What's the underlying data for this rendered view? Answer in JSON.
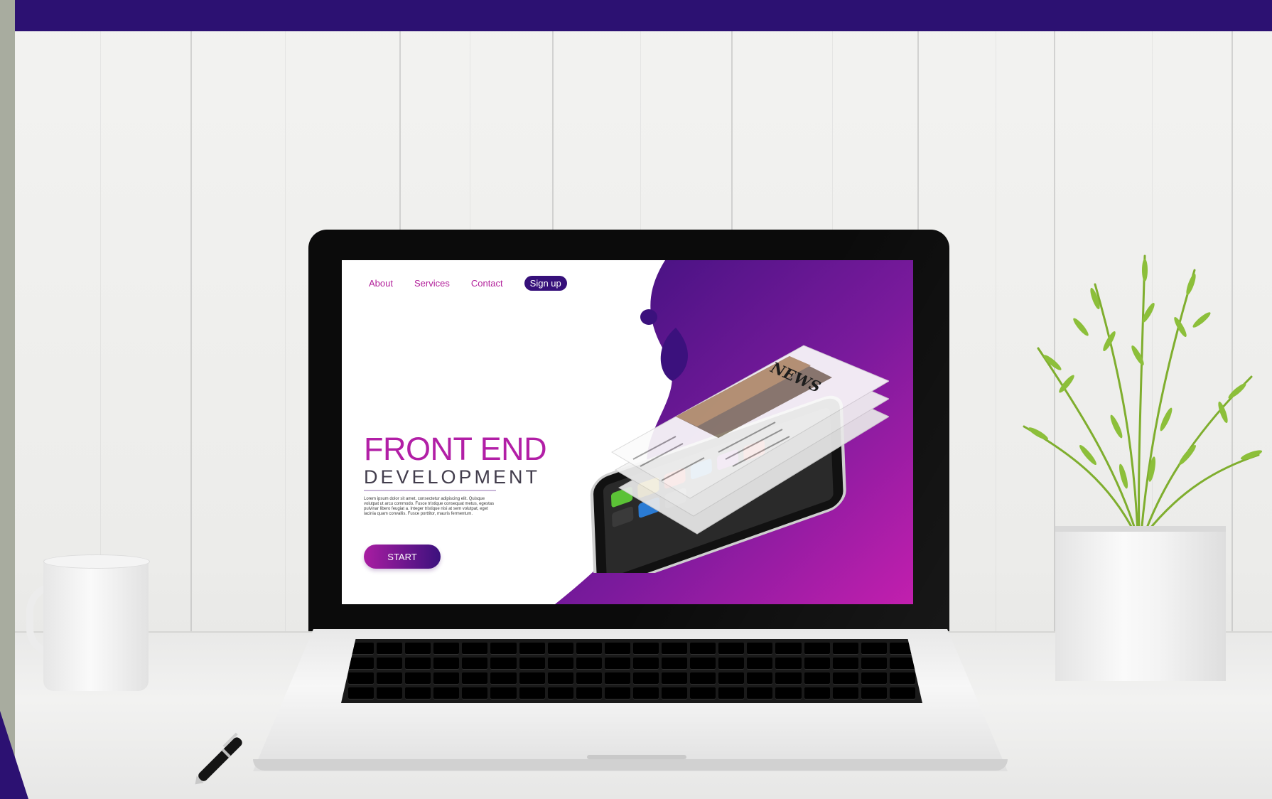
{
  "screen": {
    "nav": {
      "about": "About",
      "services": "Services",
      "contact": "Contact",
      "signup": "Sign up"
    },
    "hero": {
      "title": "FRONT END",
      "subtitle": "DEVELOPMENT",
      "body": "Lorem ipsum dolor sit amet, consectetur adipiscing elit. Quisque volutpat ut arcu commodo. Fusce tristique consequat metus, egestas pulvinar libero feugiat a. Integer tristique nisi at sem volutpat, eget lacinia quam convallis. Fusce porttitor, mauris fermentum.",
      "start_label": "START"
    },
    "mockup": {
      "news_title": "NEWS"
    }
  },
  "colors": {
    "brand_magenta": "#b21fa6",
    "brand_purple": "#36107a",
    "top_band": "#2c1172"
  }
}
